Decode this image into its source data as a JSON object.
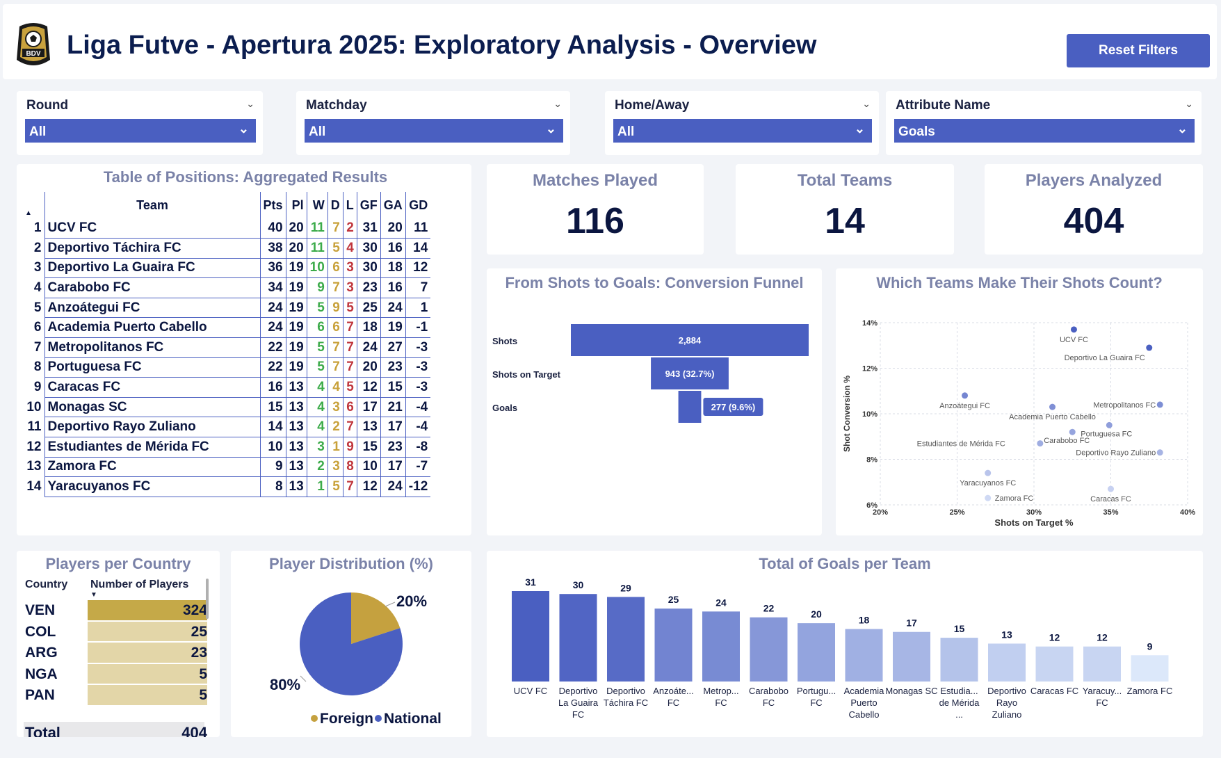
{
  "header": {
    "title": "Liga Futve - Apertura 2025: Exploratory Analysis - Overview",
    "reset_label": "Reset Filters",
    "logo_text": "BDV"
  },
  "filters": [
    {
      "label": "Round",
      "value": "All"
    },
    {
      "label": "Matchday",
      "value": "All"
    },
    {
      "label": "Home/Away",
      "value": "All"
    },
    {
      "label": "Attribute Name",
      "value": "Goals"
    }
  ],
  "standings": {
    "title": "Table of Positions: Aggregated Results",
    "columns": [
      "Team",
      "Pts",
      "Pl",
      "W",
      "D",
      "L",
      "GF",
      "GA",
      "GD"
    ],
    "rows": [
      {
        "pos": "1",
        "team": "UCV FC",
        "pts": "40",
        "pl": "20",
        "w": "11",
        "d": "7",
        "l": "2",
        "gf": "31",
        "ga": "20",
        "gd": "11"
      },
      {
        "pos": "2",
        "team": "Deportivo Táchira FC",
        "pts": "38",
        "pl": "20",
        "w": "11",
        "d": "5",
        "l": "4",
        "gf": "30",
        "ga": "16",
        "gd": "14"
      },
      {
        "pos": "3",
        "team": "Deportivo La Guaira FC",
        "pts": "36",
        "pl": "19",
        "w": "10",
        "d": "6",
        "l": "3",
        "gf": "30",
        "ga": "18",
        "gd": "12"
      },
      {
        "pos": "4",
        "team": "Carabobo FC",
        "pts": "34",
        "pl": "19",
        "w": "9",
        "d": "7",
        "l": "3",
        "gf": "23",
        "ga": "16",
        "gd": "7"
      },
      {
        "pos": "5",
        "team": "Anzoátegui FC",
        "pts": "24",
        "pl": "19",
        "w": "5",
        "d": "9",
        "l": "5",
        "gf": "25",
        "ga": "24",
        "gd": "1"
      },
      {
        "pos": "6",
        "team": "Academia Puerto Cabello",
        "pts": "24",
        "pl": "19",
        "w": "6",
        "d": "6",
        "l": "7",
        "gf": "18",
        "ga": "19",
        "gd": "-1"
      },
      {
        "pos": "7",
        "team": "Metropolitanos FC",
        "pts": "22",
        "pl": "19",
        "w": "5",
        "d": "7",
        "l": "7",
        "gf": "24",
        "ga": "27",
        "gd": "-3"
      },
      {
        "pos": "8",
        "team": "Portuguesa FC",
        "pts": "22",
        "pl": "19",
        "w": "5",
        "d": "7",
        "l": "7",
        "gf": "20",
        "ga": "23",
        "gd": "-3"
      },
      {
        "pos": "9",
        "team": "Caracas FC",
        "pts": "16",
        "pl": "13",
        "w": "4",
        "d": "4",
        "l": "5",
        "gf": "12",
        "ga": "15",
        "gd": "-3"
      },
      {
        "pos": "10",
        "team": "Monagas SC",
        "pts": "15",
        "pl": "13",
        "w": "4",
        "d": "3",
        "l": "6",
        "gf": "17",
        "ga": "21",
        "gd": "-4"
      },
      {
        "pos": "11",
        "team": "Deportivo Rayo Zuliano",
        "pts": "14",
        "pl": "13",
        "w": "4",
        "d": "2",
        "l": "7",
        "gf": "13",
        "ga": "17",
        "gd": "-4"
      },
      {
        "pos": "12",
        "team": "Estudiantes de Mérida FC",
        "pts": "10",
        "pl": "13",
        "w": "3",
        "d": "1",
        "l": "9",
        "gf": "15",
        "ga": "23",
        "gd": "-8"
      },
      {
        "pos": "13",
        "team": "Zamora FC",
        "pts": "9",
        "pl": "13",
        "w": "2",
        "d": "3",
        "l": "8",
        "gf": "10",
        "ga": "17",
        "gd": "-7"
      },
      {
        "pos": "14",
        "team": "Yaracuyanos FC",
        "pts": "8",
        "pl": "13",
        "w": "1",
        "d": "5",
        "l": "7",
        "gf": "12",
        "ga": "24",
        "gd": "-12"
      }
    ]
  },
  "kpis": [
    {
      "label": "Matches Played",
      "value": "116"
    },
    {
      "label": "Total Teams",
      "value": "14"
    },
    {
      "label": "Players Analyzed",
      "value": "404"
    }
  ],
  "chart_data": [
    {
      "type": "bar",
      "orientation": "horizontal-funnel",
      "title": "From Shots to Goals: Conversion Funnel",
      "categories": [
        "Shots",
        "Shots on Target",
        "Goals"
      ],
      "values": [
        2884,
        943,
        277
      ],
      "data_labels": [
        "2,884",
        "943 (32.7%)",
        "277 (9.6%)"
      ]
    },
    {
      "type": "scatter",
      "title": "Which Teams Make Their Shots Count?",
      "xlabel": "Shots on Target %",
      "ylabel": "Shot Conversion %",
      "xlim": [
        20,
        40
      ],
      "ylim": [
        6,
        14
      ],
      "x_ticks": [
        "20%",
        "25%",
        "30%",
        "35%",
        "40%"
      ],
      "y_ticks": [
        "6%",
        "8%",
        "10%",
        "12%",
        "14%"
      ],
      "grid": true,
      "points": [
        {
          "label": "UCV FC",
          "x": 32.6,
          "y": 13.7
        },
        {
          "label": "Deportivo La Guaira FC",
          "x": 37.5,
          "y": 12.9
        },
        {
          "label": "Anzoátegui FC",
          "x": 25.5,
          "y": 10.8
        },
        {
          "label": "Metropolitanos FC",
          "x": 38.2,
          "y": 10.4
        },
        {
          "label": "Academia Puerto Cabello",
          "x": 31.2,
          "y": 10.3
        },
        {
          "label": "Carabobo FC",
          "x": 32.5,
          "y": 9.2
        },
        {
          "label": "Portuguesa FC",
          "x": 34.9,
          "y": 9.5
        },
        {
          "label": "Estudiantes de Mérida FC",
          "x": 30.4,
          "y": 8.7
        },
        {
          "label": "Deportivo Rayo Zuliano",
          "x": 38.2,
          "y": 8.3
        },
        {
          "label": "Yaracuyanos FC",
          "x": 27.0,
          "y": 7.4
        },
        {
          "label": "Zamora FC",
          "x": 27.0,
          "y": 6.3
        },
        {
          "label": "Caracas FC",
          "x": 35.0,
          "y": 6.7
        }
      ]
    },
    {
      "type": "table",
      "title": "Players per Country",
      "columns": [
        "Country",
        "Number of Players"
      ],
      "rows": [
        {
          "country": "VEN",
          "players": 324
        },
        {
          "country": "COL",
          "players": 25
        },
        {
          "country": "ARG",
          "players": 23
        },
        {
          "country": "NGA",
          "players": 5
        },
        {
          "country": "PAN",
          "players": 5
        }
      ],
      "total_label": "Total",
      "total": 404
    },
    {
      "type": "pie",
      "title": "Player Distribution (%)",
      "categories": [
        "Foreign",
        "National"
      ],
      "values": [
        20,
        80
      ],
      "data_labels": [
        "20%",
        "80%"
      ],
      "colors": [
        "#c5a13f",
        "#4a5fc1"
      ],
      "legend": "bottom"
    },
    {
      "type": "bar",
      "title": "Total of Goals per Team",
      "categories": [
        "UCV FC",
        "Deportivo La Guaira FC",
        "Deportivo Táchira FC",
        "Anzoáte... FC",
        "Metrop... FC",
        "Carabobo FC",
        "Portugu... FC",
        "Academia Puerto Cabello",
        "Monagas SC",
        "Estudia... de Mérida ...",
        "Deportivo Rayo Zuliano",
        "Caracas FC",
        "Yaracuy... FC",
        "Zamora FC"
      ],
      "values": [
        31,
        30,
        29,
        25,
        24,
        22,
        20,
        18,
        17,
        15,
        13,
        12,
        12,
        9
      ],
      "ylim": [
        0,
        31
      ]
    }
  ],
  "colors": {
    "accent": "#4a5fc1",
    "win": "#3cab4a",
    "draw": "#c8a13a",
    "loss": "#c0353c",
    "gold": "#c5a948"
  }
}
